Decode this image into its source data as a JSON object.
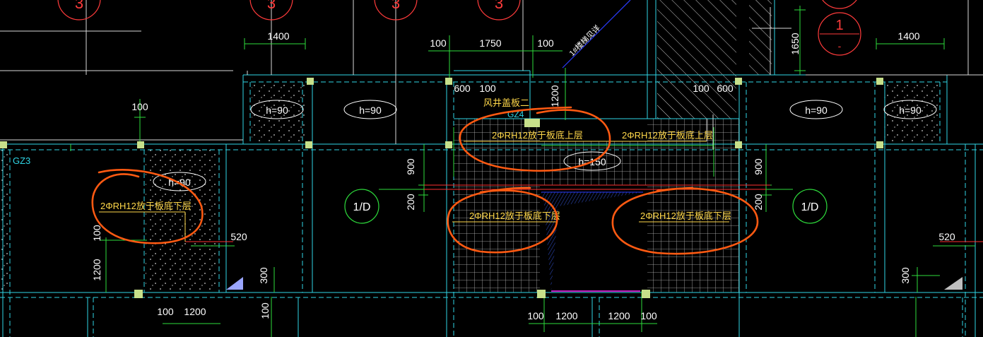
{
  "axis_bubbles": [
    {
      "text": "3"
    },
    {
      "text": "3"
    },
    {
      "text": "3"
    },
    {
      "text": "3"
    },
    {
      "text": "1",
      "sub": "-"
    },
    {
      "text": "1/D"
    },
    {
      "text": "1/D"
    }
  ],
  "dimensions": {
    "d1400a": "1400",
    "d100a": "100",
    "d1750": "1750",
    "d100b": "100",
    "d1650": "1650",
    "d1400b": "1400",
    "d100c": "100",
    "d600a": "600",
    "d100d": "100",
    "d1200a": "1200",
    "d100e": "100",
    "d600b": "600",
    "d900a": "900",
    "d200a": "200",
    "d900b": "900",
    "d200b": "200",
    "d100f": "100",
    "d520a": "520",
    "d1200b": "1200",
    "d300a": "300",
    "d520b": "520",
    "d300b": "300",
    "d100g": "100",
    "d1200c": "1200",
    "d100h": "100",
    "d100i": "100",
    "d1200d": "1200",
    "d1200e": "1200",
    "d100j": "100"
  },
  "slab_tags": {
    "h1": "h=90",
    "h2": "h=90",
    "h3": "h=90",
    "h4": "h=90",
    "h5": "h=90",
    "h6": "h=150"
  },
  "labels": {
    "gz3": "GZ3",
    "gz4": "GZ4",
    "vent_cover": "风井盖板二",
    "stair": "1#楼梯见详",
    "rebar_top_1": "2ΦRH12放于板底上层",
    "rebar_top_2": "2ΦRH12放于板底上层",
    "rebar_bottom_1": "2ΦRH12放于板底下层",
    "rebar_bottom_2": "2ΦRH12放于板底下层",
    "rebar_bottom_3": "2ΦRH12放于板底下层"
  },
  "colors": {
    "background": "#000000",
    "markup": "#ff5a12",
    "grid_lines": "#2fd6e6",
    "dimension_lines": "#2edc3c",
    "text": "#ffffff",
    "rebar_text": "#ffd84a",
    "axis_bubble": "#ff3b3b",
    "column": "#c7e08a"
  }
}
